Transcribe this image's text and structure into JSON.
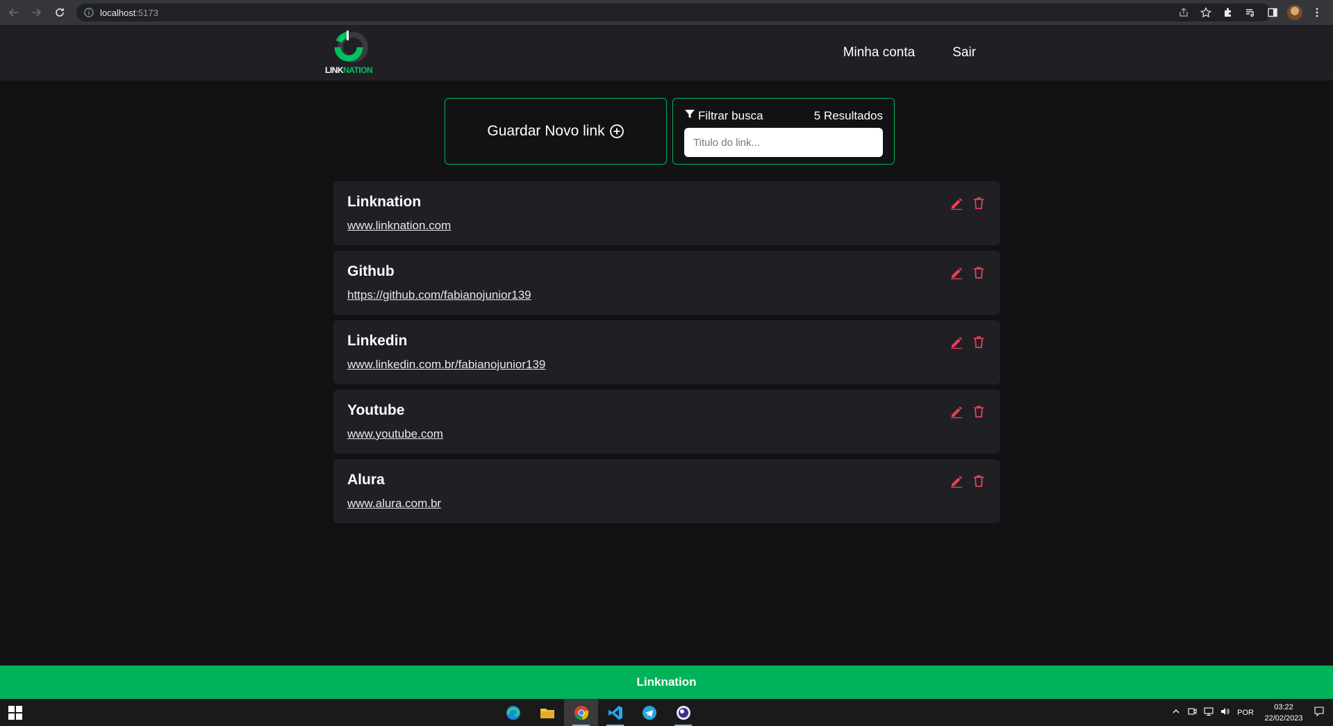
{
  "browser": {
    "url_host": "localhost",
    "url_port": ":5173"
  },
  "header": {
    "logo_text_a": "LINK",
    "logo_text_b": "NATION",
    "nav": [
      {
        "label": "Minha conta"
      },
      {
        "label": "Sair"
      }
    ]
  },
  "controls": {
    "new_link_label": "Guardar Novo link",
    "filter_label": "Filtrar busca",
    "results": "5 Resultados",
    "filter_placeholder": "Titulo do link..."
  },
  "links": [
    {
      "title": "Linknation",
      "url": "www.linknation.com"
    },
    {
      "title": "Github",
      "url": "https://github.com/fabianojunior139"
    },
    {
      "title": "Linkedin",
      "url": "www.linkedin.com.br/fabianojunior139"
    },
    {
      "title": "Youtube",
      "url": "www.youtube.com"
    },
    {
      "title": "Alura",
      "url": "www.alura.com.br"
    }
  ],
  "footer": {
    "label": "Linknation"
  },
  "taskbar": {
    "language": "POR",
    "time": "03:22",
    "date": "22/02/2023"
  },
  "colors": {
    "accent": "#00b35a",
    "danger": "#e83f5b",
    "background": "#121214",
    "surface": "#202024"
  }
}
